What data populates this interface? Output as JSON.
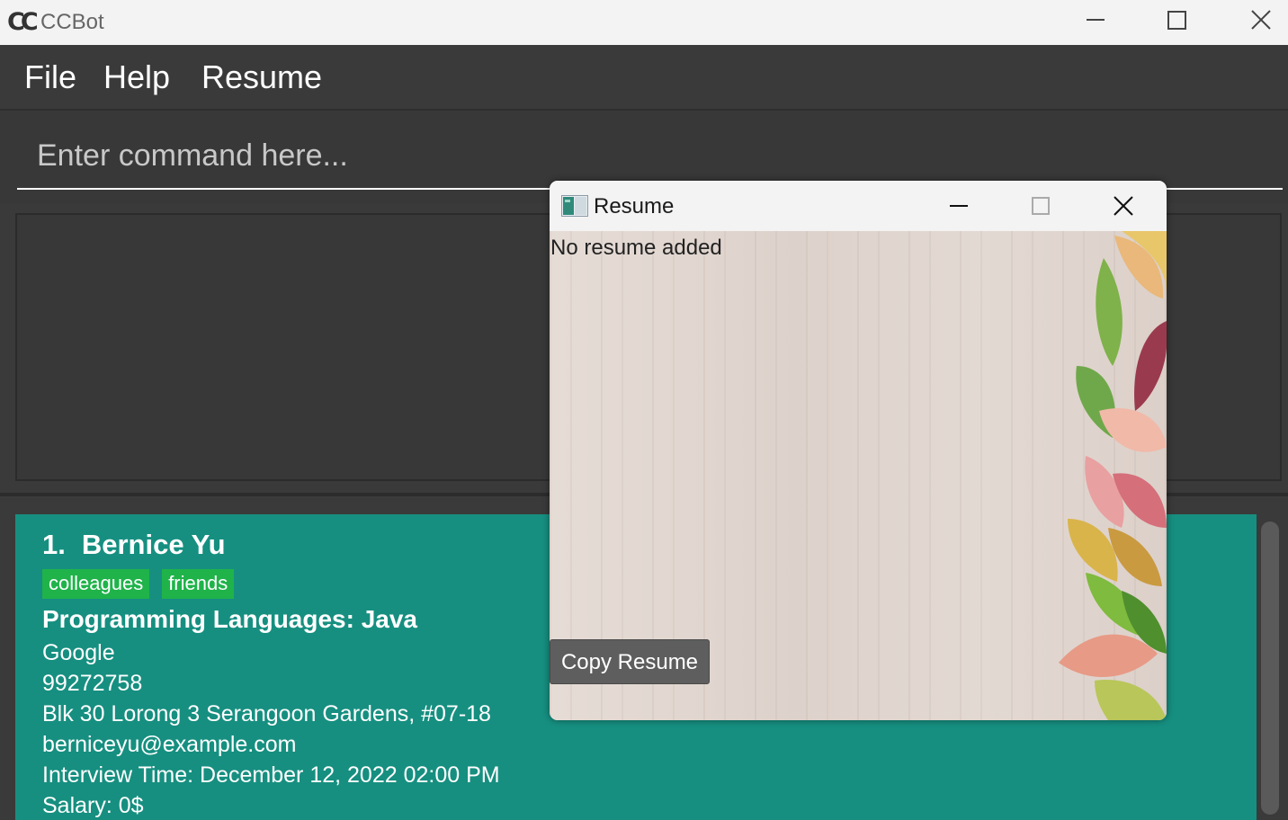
{
  "window": {
    "app_title": "CCBot",
    "logo_text": "CC"
  },
  "menu": {
    "file": "File",
    "help": "Help",
    "resume": "Resume"
  },
  "command": {
    "placeholder": "Enter command here..."
  },
  "result_display": {
    "text": ""
  },
  "persons": [
    {
      "index": "1.",
      "name": "Bernice Yu",
      "tags": [
        "colleagues",
        "friends"
      ],
      "programming_languages": "Programming Languages: Java",
      "company": "Google",
      "phone": "99272758",
      "address": "Blk 30 Lorong 3 Serangoon Gardens, #07-18",
      "email": "berniceyu@example.com",
      "interview_time": "Interview Time: December 12, 2022 02:00 PM",
      "salary": "Salary: 0$"
    }
  ],
  "resume_popup": {
    "title": "Resume",
    "message": "No resume added",
    "copy_button": "Copy Resume"
  },
  "colors": {
    "app_background": "#3a3a3a",
    "card_background": "#168f80",
    "tag_background": "#1fb34a",
    "button_background": "#5e5e5e"
  },
  "icons": [
    "minimize-icon",
    "maximize-icon",
    "close-icon",
    "app-logo-icon",
    "resume-window-icon"
  ]
}
